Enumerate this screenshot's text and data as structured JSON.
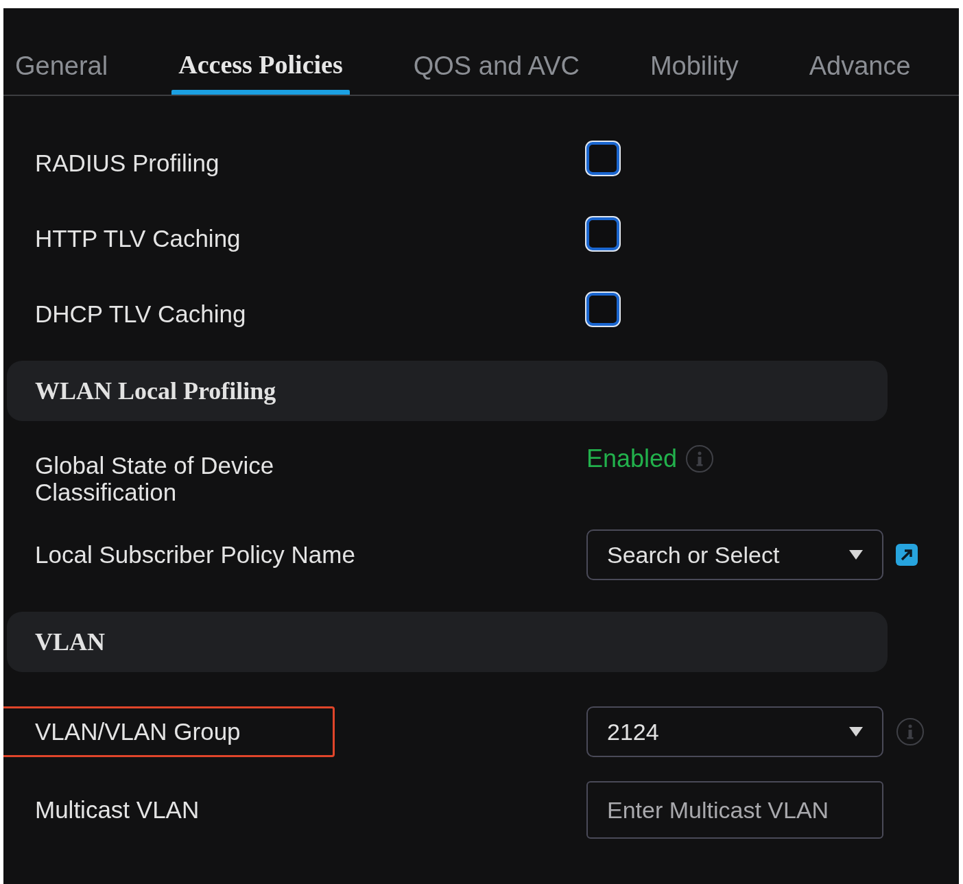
{
  "tabs": [
    {
      "label": "General",
      "selected": false
    },
    {
      "label": "Access Policies",
      "selected": true
    },
    {
      "label": "QOS and AVC",
      "selected": false
    },
    {
      "label": "Mobility",
      "selected": false
    },
    {
      "label": "Advance",
      "selected": false
    }
  ],
  "rows": [
    {
      "kind": "checkbox",
      "label": "RADIUS Profiling",
      "checked": false,
      "highlighted": false
    },
    {
      "kind": "checkbox",
      "label": "HTTP TLV Caching",
      "checked": false,
      "highlighted": false
    },
    {
      "kind": "checkbox",
      "label": "DHCP TLV Caching",
      "checked": false,
      "highlighted": false
    },
    {
      "kind": "section",
      "title": "WLAN Local Profiling"
    },
    {
      "kind": "status",
      "label": "Global State of Device Classification",
      "value": "Enabled",
      "highlighted": false
    },
    {
      "kind": "lookup",
      "label": "Local Subscriber Policy Name",
      "placeholder": "Search or Select",
      "highlighted": false
    },
    {
      "kind": "section",
      "title": "VLAN"
    },
    {
      "kind": "select",
      "label": "VLAN/VLAN Group",
      "value": "2124",
      "highlighted": true
    },
    {
      "kind": "input",
      "label": "Multicast VLAN",
      "placeholder": "Enter Multicast VLAN",
      "highlighted": false
    }
  ]
}
